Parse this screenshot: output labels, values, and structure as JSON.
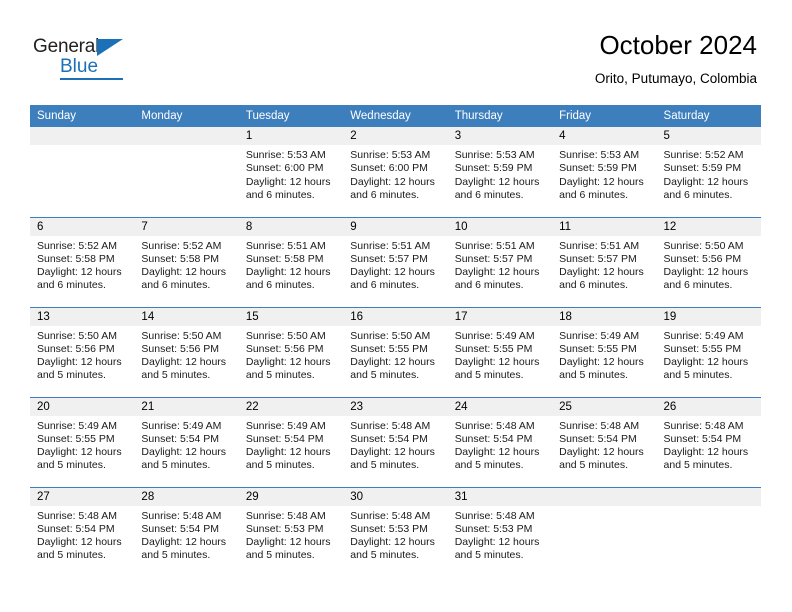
{
  "brand": {
    "name_top": "General",
    "name_bottom": "Blue",
    "accent_color": "#1b70b8"
  },
  "header": {
    "title": "October 2024",
    "subtitle": "Orito, Putumayo, Colombia"
  },
  "theme": {
    "header_row_bg": "#3d7ebd",
    "daynum_bg": "#f0f0f0",
    "grid_line": "#3d7ebd"
  },
  "weekday_headers": [
    "Sunday",
    "Monday",
    "Tuesday",
    "Wednesday",
    "Thursday",
    "Friday",
    "Saturday"
  ],
  "labels": {
    "sunrise_prefix": "Sunrise:",
    "sunset_prefix": "Sunset:",
    "daylight_prefix": "Daylight:"
  },
  "weeks": [
    [
      {
        "day": "",
        "blank": true
      },
      {
        "day": "",
        "blank": true
      },
      {
        "day": "1",
        "sunrise": "Sunrise: 5:53 AM",
        "sunset": "Sunset: 6:00 PM",
        "daylight_1": "Daylight: 12 hours",
        "daylight_2": "and 6 minutes."
      },
      {
        "day": "2",
        "sunrise": "Sunrise: 5:53 AM",
        "sunset": "Sunset: 6:00 PM",
        "daylight_1": "Daylight: 12 hours",
        "daylight_2": "and 6 minutes."
      },
      {
        "day": "3",
        "sunrise": "Sunrise: 5:53 AM",
        "sunset": "Sunset: 5:59 PM",
        "daylight_1": "Daylight: 12 hours",
        "daylight_2": "and 6 minutes."
      },
      {
        "day": "4",
        "sunrise": "Sunrise: 5:53 AM",
        "sunset": "Sunset: 5:59 PM",
        "daylight_1": "Daylight: 12 hours",
        "daylight_2": "and 6 minutes."
      },
      {
        "day": "5",
        "sunrise": "Sunrise: 5:52 AM",
        "sunset": "Sunset: 5:59 PM",
        "daylight_1": "Daylight: 12 hours",
        "daylight_2": "and 6 minutes."
      }
    ],
    [
      {
        "day": "6",
        "sunrise": "Sunrise: 5:52 AM",
        "sunset": "Sunset: 5:58 PM",
        "daylight_1": "Daylight: 12 hours",
        "daylight_2": "and 6 minutes."
      },
      {
        "day": "7",
        "sunrise": "Sunrise: 5:52 AM",
        "sunset": "Sunset: 5:58 PM",
        "daylight_1": "Daylight: 12 hours",
        "daylight_2": "and 6 minutes."
      },
      {
        "day": "8",
        "sunrise": "Sunrise: 5:51 AM",
        "sunset": "Sunset: 5:58 PM",
        "daylight_1": "Daylight: 12 hours",
        "daylight_2": "and 6 minutes."
      },
      {
        "day": "9",
        "sunrise": "Sunrise: 5:51 AM",
        "sunset": "Sunset: 5:57 PM",
        "daylight_1": "Daylight: 12 hours",
        "daylight_2": "and 6 minutes."
      },
      {
        "day": "10",
        "sunrise": "Sunrise: 5:51 AM",
        "sunset": "Sunset: 5:57 PM",
        "daylight_1": "Daylight: 12 hours",
        "daylight_2": "and 6 minutes."
      },
      {
        "day": "11",
        "sunrise": "Sunrise: 5:51 AM",
        "sunset": "Sunset: 5:57 PM",
        "daylight_1": "Daylight: 12 hours",
        "daylight_2": "and 6 minutes."
      },
      {
        "day": "12",
        "sunrise": "Sunrise: 5:50 AM",
        "sunset": "Sunset: 5:56 PM",
        "daylight_1": "Daylight: 12 hours",
        "daylight_2": "and 6 minutes."
      }
    ],
    [
      {
        "day": "13",
        "sunrise": "Sunrise: 5:50 AM",
        "sunset": "Sunset: 5:56 PM",
        "daylight_1": "Daylight: 12 hours",
        "daylight_2": "and 5 minutes."
      },
      {
        "day": "14",
        "sunrise": "Sunrise: 5:50 AM",
        "sunset": "Sunset: 5:56 PM",
        "daylight_1": "Daylight: 12 hours",
        "daylight_2": "and 5 minutes."
      },
      {
        "day": "15",
        "sunrise": "Sunrise: 5:50 AM",
        "sunset": "Sunset: 5:56 PM",
        "daylight_1": "Daylight: 12 hours",
        "daylight_2": "and 5 minutes."
      },
      {
        "day": "16",
        "sunrise": "Sunrise: 5:50 AM",
        "sunset": "Sunset: 5:55 PM",
        "daylight_1": "Daylight: 12 hours",
        "daylight_2": "and 5 minutes."
      },
      {
        "day": "17",
        "sunrise": "Sunrise: 5:49 AM",
        "sunset": "Sunset: 5:55 PM",
        "daylight_1": "Daylight: 12 hours",
        "daylight_2": "and 5 minutes."
      },
      {
        "day": "18",
        "sunrise": "Sunrise: 5:49 AM",
        "sunset": "Sunset: 5:55 PM",
        "daylight_1": "Daylight: 12 hours",
        "daylight_2": "and 5 minutes."
      },
      {
        "day": "19",
        "sunrise": "Sunrise: 5:49 AM",
        "sunset": "Sunset: 5:55 PM",
        "daylight_1": "Daylight: 12 hours",
        "daylight_2": "and 5 minutes."
      }
    ],
    [
      {
        "day": "20",
        "sunrise": "Sunrise: 5:49 AM",
        "sunset": "Sunset: 5:55 PM",
        "daylight_1": "Daylight: 12 hours",
        "daylight_2": "and 5 minutes."
      },
      {
        "day": "21",
        "sunrise": "Sunrise: 5:49 AM",
        "sunset": "Sunset: 5:54 PM",
        "daylight_1": "Daylight: 12 hours",
        "daylight_2": "and 5 minutes."
      },
      {
        "day": "22",
        "sunrise": "Sunrise: 5:49 AM",
        "sunset": "Sunset: 5:54 PM",
        "daylight_1": "Daylight: 12 hours",
        "daylight_2": "and 5 minutes."
      },
      {
        "day": "23",
        "sunrise": "Sunrise: 5:48 AM",
        "sunset": "Sunset: 5:54 PM",
        "daylight_1": "Daylight: 12 hours",
        "daylight_2": "and 5 minutes."
      },
      {
        "day": "24",
        "sunrise": "Sunrise: 5:48 AM",
        "sunset": "Sunset: 5:54 PM",
        "daylight_1": "Daylight: 12 hours",
        "daylight_2": "and 5 minutes."
      },
      {
        "day": "25",
        "sunrise": "Sunrise: 5:48 AM",
        "sunset": "Sunset: 5:54 PM",
        "daylight_1": "Daylight: 12 hours",
        "daylight_2": "and 5 minutes."
      },
      {
        "day": "26",
        "sunrise": "Sunrise: 5:48 AM",
        "sunset": "Sunset: 5:54 PM",
        "daylight_1": "Daylight: 12 hours",
        "daylight_2": "and 5 minutes."
      }
    ],
    [
      {
        "day": "27",
        "sunrise": "Sunrise: 5:48 AM",
        "sunset": "Sunset: 5:54 PM",
        "daylight_1": "Daylight: 12 hours",
        "daylight_2": "and 5 minutes."
      },
      {
        "day": "28",
        "sunrise": "Sunrise: 5:48 AM",
        "sunset": "Sunset: 5:54 PM",
        "daylight_1": "Daylight: 12 hours",
        "daylight_2": "and 5 minutes."
      },
      {
        "day": "29",
        "sunrise": "Sunrise: 5:48 AM",
        "sunset": "Sunset: 5:53 PM",
        "daylight_1": "Daylight: 12 hours",
        "daylight_2": "and 5 minutes."
      },
      {
        "day": "30",
        "sunrise": "Sunrise: 5:48 AM",
        "sunset": "Sunset: 5:53 PM",
        "daylight_1": "Daylight: 12 hours",
        "daylight_2": "and 5 minutes."
      },
      {
        "day": "31",
        "sunrise": "Sunrise: 5:48 AM",
        "sunset": "Sunset: 5:53 PM",
        "daylight_1": "Daylight: 12 hours",
        "daylight_2": "and 5 minutes."
      },
      {
        "day": "",
        "blank": true
      },
      {
        "day": "",
        "blank": true
      }
    ]
  ]
}
